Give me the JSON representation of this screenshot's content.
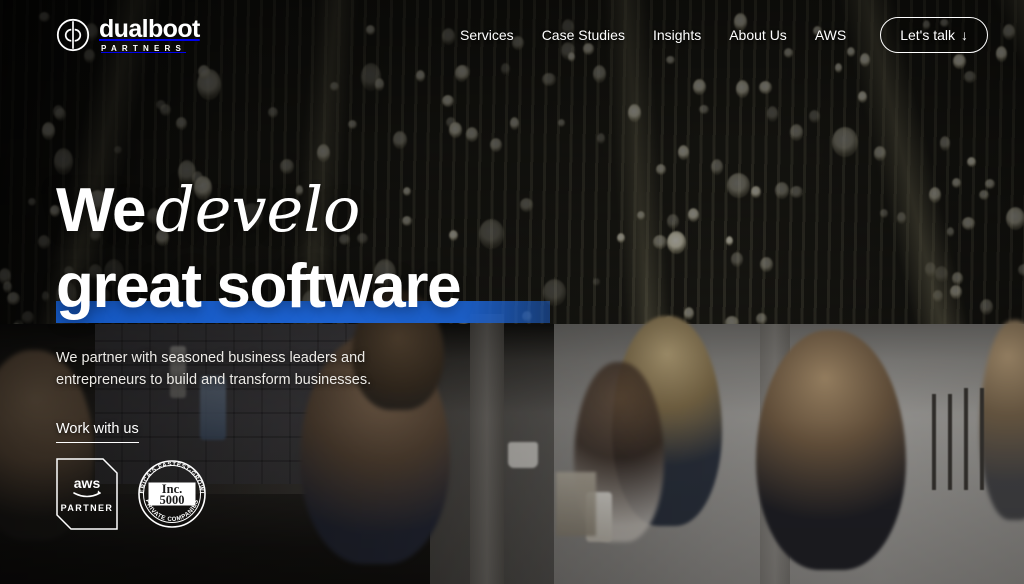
{
  "brand": {
    "logo_word": "dualboot",
    "logo_sub": "PARTNERS",
    "logo_icon": "dualboot-circle-monogram-icon"
  },
  "nav": {
    "items": [
      {
        "label": "Services"
      },
      {
        "label": "Case Studies"
      },
      {
        "label": "Insights"
      },
      {
        "label": "About Us"
      },
      {
        "label": "AWS"
      }
    ],
    "cta": {
      "label": "Let's talk",
      "icon": "arrow-down-icon",
      "glyph": "↓"
    }
  },
  "hero": {
    "headline_static": "We",
    "headline_typed": "develo",
    "headline_line2": "great software",
    "highlight_color": "#1557c0",
    "subtitle": "We partner with seasoned business leaders and entrepreneurs to build and transform businesses.",
    "cta_link": "Work with us"
  },
  "badges": [
    {
      "name": "aws-partner-badge",
      "brand": "aws",
      "tier": "PARTNER"
    },
    {
      "name": "inc-5000-badge",
      "title_top": "AMERICA'S FASTEST-GROWING",
      "title_bottom": "PRIVATE COMPANIES",
      "mark_line1": "Inc.",
      "mark_line2": "5000"
    }
  ]
}
